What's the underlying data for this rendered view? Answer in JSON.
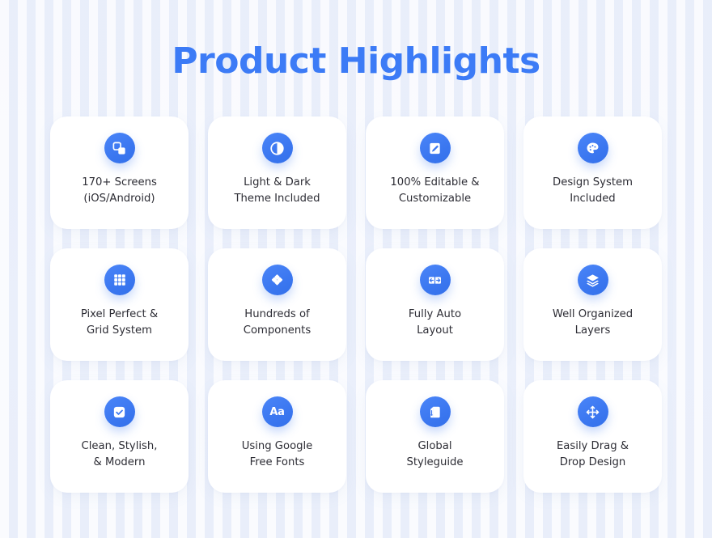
{
  "page": {
    "title": "Product Highlights",
    "background_color": "#f3f6fd",
    "accent_color": "#3b77f0",
    "title_color": "#3c7bf6",
    "card_background": "#ffffff",
    "label_color": "#2d2d35"
  },
  "cards": [
    {
      "label": "170+ Screens\n(iOS/Android)",
      "icon": "screens-stack-icon"
    },
    {
      "label": "Light & Dark\nTheme Included",
      "icon": "contrast-half-circle-icon"
    },
    {
      "label": "100% Editable &\nCustomizable",
      "icon": "edit-pencil-square-icon"
    },
    {
      "label": "Design System\nIncluded",
      "icon": "paint-palette-icon"
    },
    {
      "label": "Pixel Perfect &\nGrid System",
      "icon": "grid-nine-squares-icon"
    },
    {
      "label": "Hundreds of\nComponents",
      "icon": "four-diamonds-component-icon"
    },
    {
      "label": "Fully Auto\nLayout",
      "icon": "auto-layout-horizontal-icon"
    },
    {
      "label": "Well Organized\nLayers",
      "icon": "layers-stack-icon"
    },
    {
      "label": "Clean, Stylish,\n& Modern",
      "icon": "checkbox-check-icon"
    },
    {
      "label": "Using Google\nFree Fonts",
      "icon": "typography-aa-icon"
    },
    {
      "label": "Global\nStyleguide",
      "icon": "styleguide-paint-icon"
    },
    {
      "label": "Easily Drag &\nDrop Design",
      "icon": "move-four-arrows-icon"
    }
  ]
}
